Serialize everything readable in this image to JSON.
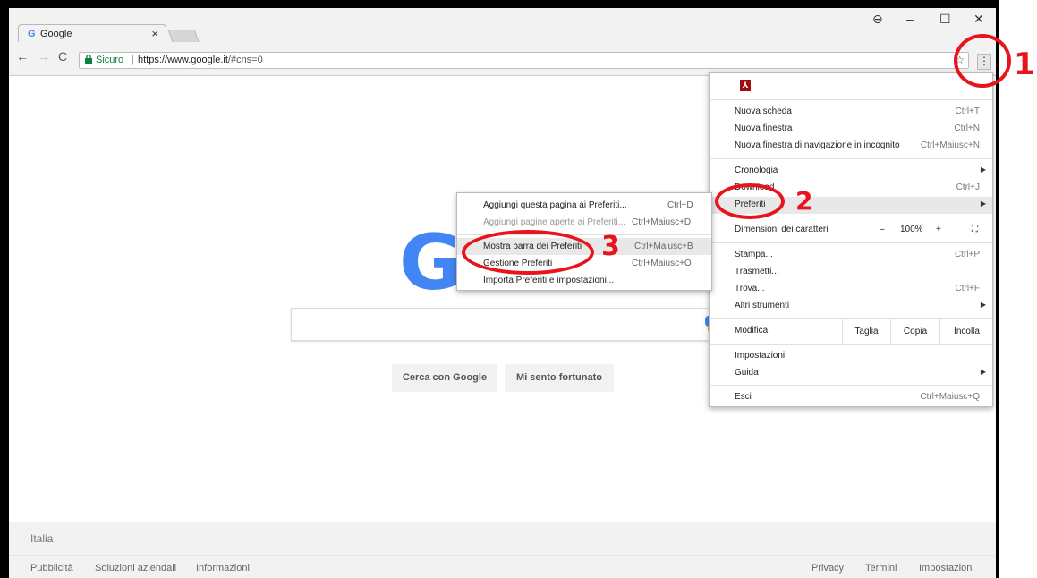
{
  "browser": {
    "tab_title": "Google",
    "tab_favicon": "G",
    "tab_close": "×",
    "window_controls": {
      "user": "⊖",
      "minimize": "–",
      "maximize": "☐",
      "close": "✕"
    }
  },
  "toolbar": {
    "back": "←",
    "forward": "→",
    "reload": "C",
    "secure_label": "Sicuro",
    "url_base": "https://www.google.it",
    "url_tail": "/#cns=0",
    "menu_glyph": "⋮"
  },
  "page": {
    "logo_letter": "G",
    "search_button": "Cerca con Google",
    "lucky_button": "Mi sento fortunato",
    "footer": {
      "country": "Italia",
      "left_links": [
        "Pubblicità",
        "Soluzioni aziendali",
        "Informazioni"
      ],
      "right_links": [
        "Privacy",
        "Termini",
        "Impostazioni"
      ]
    }
  },
  "menu": {
    "items": {
      "new_tab": {
        "label": "Nuova scheda",
        "shortcut": "Ctrl+T"
      },
      "new_window": {
        "label": "Nuova finestra",
        "shortcut": "Ctrl+N"
      },
      "incognito": {
        "label": "Nuova finestra di navigazione in incognito",
        "shortcut": "Ctrl+Maiusc+N"
      },
      "history": {
        "label": "Cronologia"
      },
      "downloads": {
        "label": "Download",
        "shortcut": "Ctrl+J"
      },
      "bookmarks": {
        "label": "Preferiti"
      },
      "zoom": {
        "label": "Dimensioni dei caratteri",
        "minus": "–",
        "value": "100%",
        "plus": "+",
        "fullscreen": "⛶"
      },
      "print": {
        "label": "Stampa...",
        "shortcut": "Ctrl+P"
      },
      "cast": {
        "label": "Trasmetti..."
      },
      "find": {
        "label": "Trova...",
        "shortcut": "Ctrl+F"
      },
      "more_tools": {
        "label": "Altri strumenti"
      },
      "edit": {
        "label": "Modifica",
        "cut": "Taglia",
        "copy": "Copia",
        "paste": "Incolla"
      },
      "settings": {
        "label": "Impostazioni"
      },
      "help": {
        "label": "Guida"
      },
      "exit": {
        "label": "Esci",
        "shortcut": "Ctrl+Maiusc+Q"
      }
    },
    "pdf_icon_glyph": "⅄"
  },
  "submenu": {
    "items": [
      {
        "label": "Aggiungi questa pagina ai Preferiti...",
        "shortcut": "Ctrl+D",
        "disabled": false
      },
      {
        "label": "Aggiungi pagine aperte ai Preferiti...",
        "shortcut": "Ctrl+Maiusc+D",
        "disabled": true
      },
      {
        "label": "Mostra barra dei Preferiti",
        "shortcut": "Ctrl+Maiusc+B",
        "disabled": false
      },
      {
        "label": "Gestione Preferiti",
        "shortcut": "Ctrl+Maiusc+O",
        "disabled": false
      },
      {
        "label": "Importa Preferiti e impostazioni...",
        "shortcut": "",
        "disabled": false
      }
    ]
  },
  "annotations": {
    "step1": "1",
    "step2": "2",
    "step3": "3",
    "color": "#e8141b"
  }
}
